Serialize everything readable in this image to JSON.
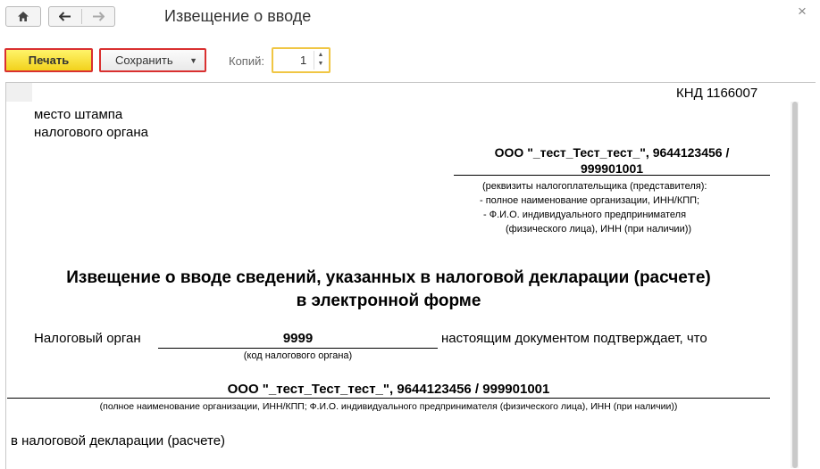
{
  "window": {
    "title": "Извещение о вводе"
  },
  "toolbar": {
    "print_label": "Печать",
    "save_label": "Сохранить",
    "copies_label": "Копий:",
    "copies_value": "1"
  },
  "doc": {
    "knd": "КНД 1166007",
    "stamp_line1": "место штампа",
    "stamp_line2": "налогового органа",
    "taxpayer_line1": "ООО \"_тест_Тест_тест_\", 9644123456 /",
    "taxpayer_line2": "999901001",
    "requisites": [
      "(реквизиты налогоплательщика (представителя):",
      "- полное наименование организации, ИНН/КПП;",
      "- Ф.И.О. индивидуального предпринимателя",
      "(физического лица), ИНН (при наличии))"
    ],
    "heading_line1": "Извещение о вводе сведений, указанных в налоговой декларации (расчете)",
    "heading_line2": "в электронной форме",
    "tax_organ_label": "Налоговый орган",
    "tax_organ_code": "9999",
    "confirm_text": "настоящим документом подтверждает, что",
    "tax_organ_hint": "(код налогового органа)",
    "org_full": "ООО \"_тест_Тест_тест_\", 9644123456 / 999901001",
    "org_hint": "(полное наименование организации, ИНН/КПП; Ф.И.О. индивидуального предпринимателя (физического лица), ИНН (при наличии))",
    "declaration_text": "в налоговой декларации (расчете)"
  }
}
